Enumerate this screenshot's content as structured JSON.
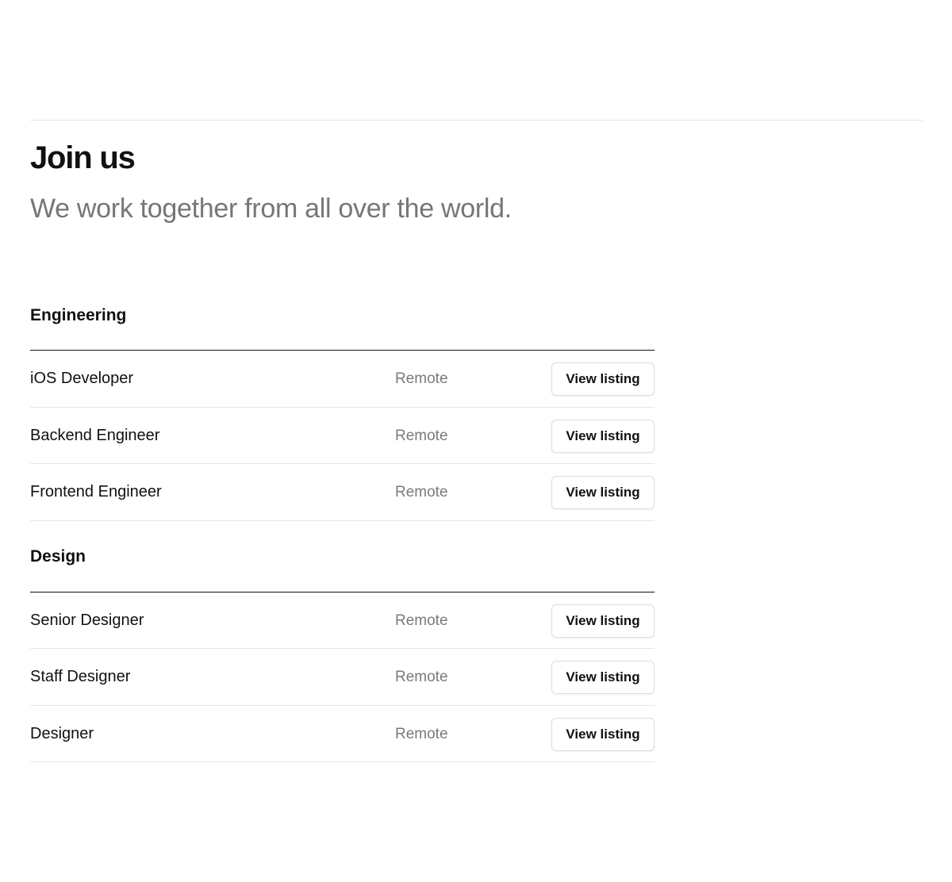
{
  "header": {
    "title": "Join us",
    "subtitle": "We work together from all over the world."
  },
  "departments": [
    {
      "name": "Engineering",
      "jobs": [
        {
          "title": "iOS Developer",
          "location": "Remote",
          "button": "View listing"
        },
        {
          "title": "Backend Engineer",
          "location": "Remote",
          "button": "View listing"
        },
        {
          "title": "Frontend Engineer",
          "location": "Remote",
          "button": "View listing"
        }
      ]
    },
    {
      "name": "Design",
      "jobs": [
        {
          "title": "Senior Designer",
          "location": "Remote",
          "button": "View listing"
        },
        {
          "title": "Staff Designer",
          "location": "Remote",
          "button": "View listing"
        },
        {
          "title": "Designer",
          "location": "Remote",
          "button": "View listing"
        }
      ]
    }
  ]
}
